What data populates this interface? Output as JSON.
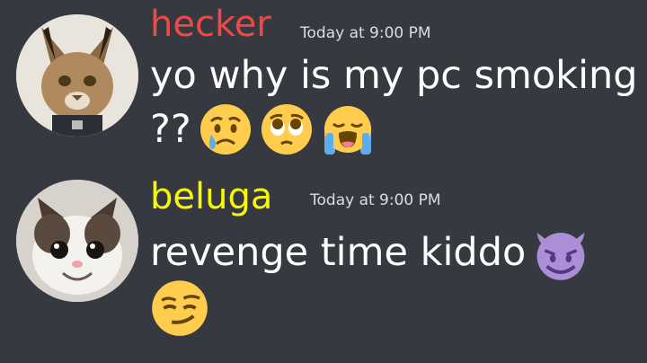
{
  "messages": [
    {
      "username": "hecker",
      "username_color": "#f04747",
      "timestamp": "Today at 9:00 PM",
      "line1": "yo why is my pc smoking",
      "line2": "??",
      "emojis": [
        "crying-face",
        "pleading-face",
        "loudly-crying-face"
      ]
    },
    {
      "username": "beluga",
      "username_color": "#f8f800",
      "timestamp": "Today at 9:00 PM",
      "line1": "revenge time kiddo",
      "emojis": [
        "smiling-devil",
        "smirking-face"
      ]
    }
  ],
  "colors": {
    "background": "#36393f",
    "text": "#ffffff",
    "timestamp": "#dcddde"
  }
}
